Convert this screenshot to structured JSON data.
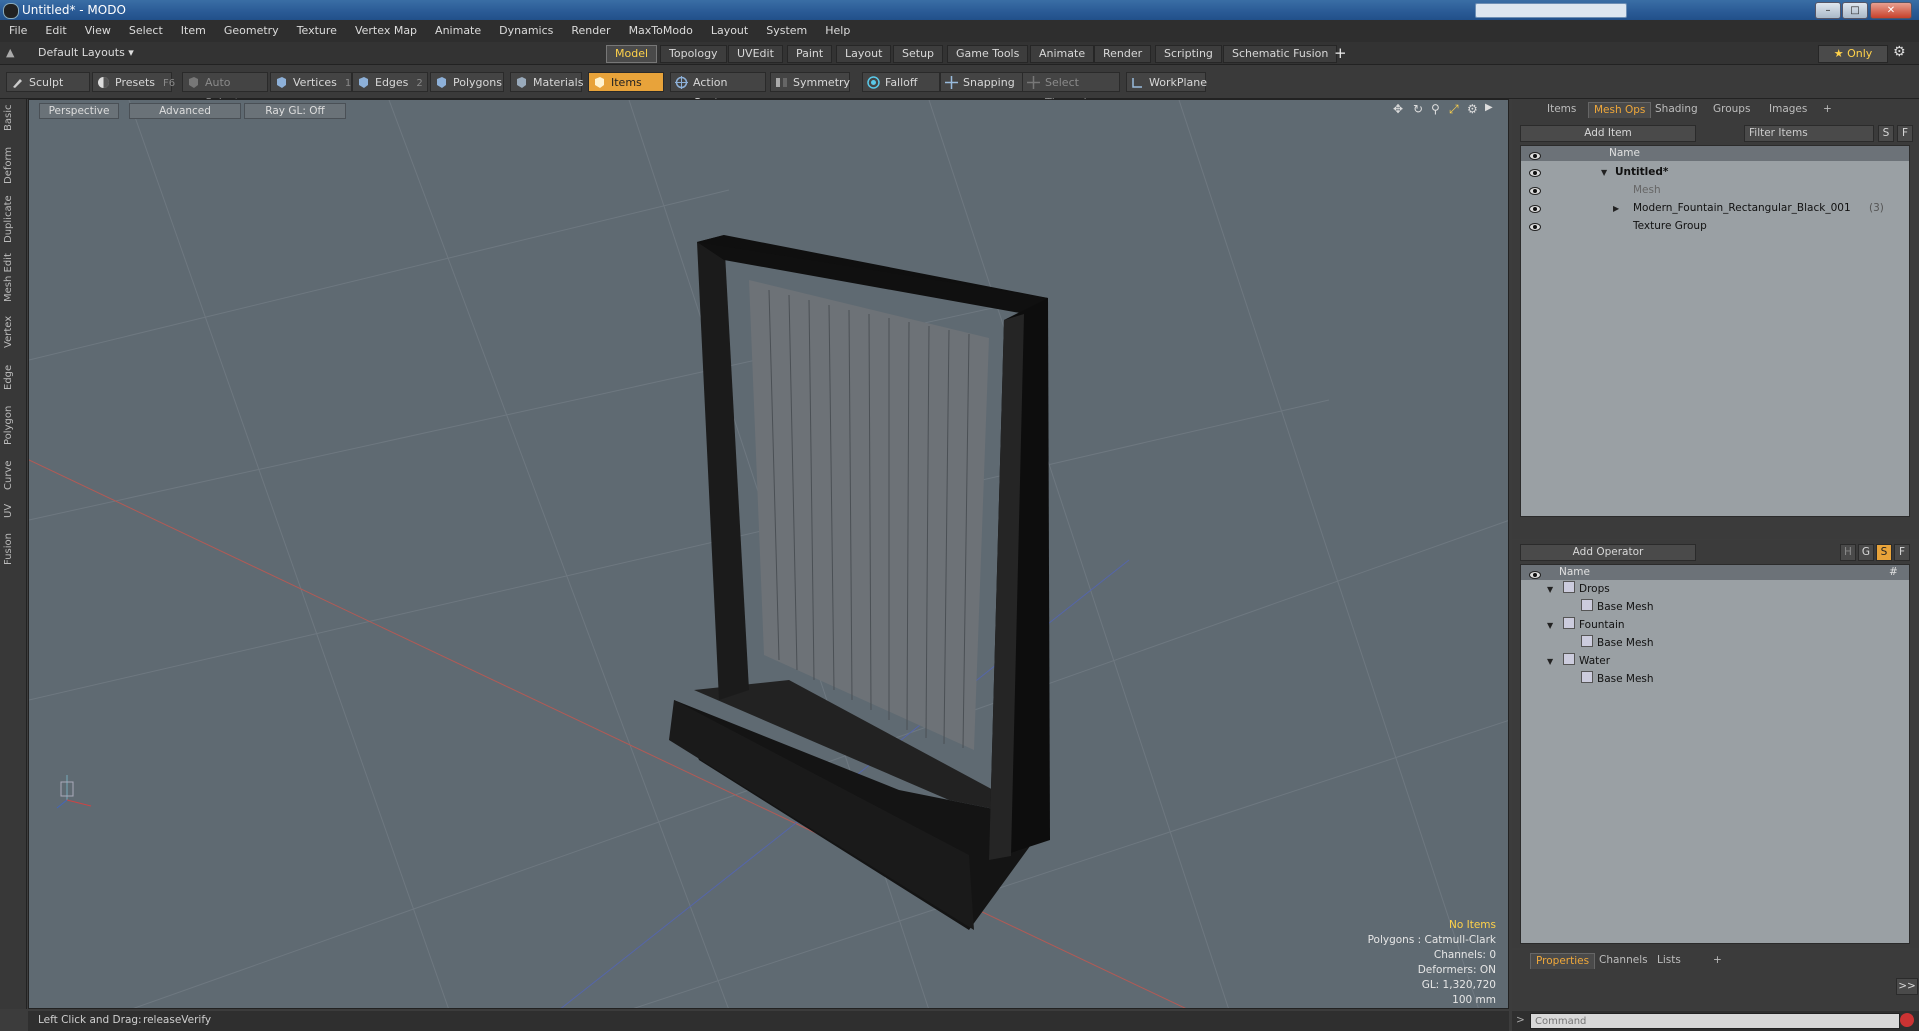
{
  "window": {
    "title": "Untitled* - MODO"
  },
  "menu": [
    "File",
    "Edit",
    "View",
    "Select",
    "Item",
    "Geometry",
    "Texture",
    "Vertex Map",
    "Animate",
    "Dynamics",
    "Render",
    "MaxToModo",
    "Layout",
    "System",
    "Help"
  ],
  "layoutbar": {
    "layouts_label": "Default Layouts ▾",
    "tabs": [
      "Model",
      "Topology",
      "UVEdit",
      "Paint",
      "Layout",
      "Setup",
      "Game Tools",
      "Animate",
      "Render",
      "Scripting",
      "Schematic Fusion"
    ],
    "active_tab": "Model",
    "add_label": "+",
    "only_label": "★ Only"
  },
  "toolbar": {
    "sculpt": "Sculpt",
    "presets": "Presets",
    "presets_key": "F6",
    "auto_select": "Auto Select",
    "vertices": "Vertices",
    "vertices_key": "1",
    "edges": "Edges",
    "edges_key": "2",
    "polygons": "Polygons",
    "materials": "Materials",
    "items": "Items",
    "action_center": "Action Center",
    "symmetry": "Symmetry",
    "falloff": "Falloff",
    "snapping": "Snapping",
    "select_through": "Select Through",
    "workplane": "WorkPlane"
  },
  "left_tabs": [
    "Basic",
    "Deform",
    "Duplicate",
    "Mesh Edit",
    "Vertex",
    "Edge",
    "Polygon",
    "Curve",
    "UV",
    "Fusion"
  ],
  "viewport": {
    "perspective": "Perspective",
    "advanced": "Advanced",
    "raygl": "Ray GL: Off",
    "info": {
      "items": "No Items",
      "polygons": "Polygons : Catmull-Clark",
      "channels": "Channels: 0",
      "deformers": "Deformers: ON",
      "gl": "GL: 1,320,720",
      "scale": "100 mm"
    }
  },
  "item_panel": {
    "tabs": [
      "Items",
      "Mesh Ops",
      "Shading",
      "Groups",
      "Images",
      "+"
    ],
    "active_tab": "Mesh Ops",
    "add_item": "Add Item",
    "filter_items": "Filter Items",
    "s_btn": "S",
    "f_btn": "F",
    "col_name": "Name",
    "tree": [
      {
        "label": "Untitled*",
        "count": ""
      },
      {
        "label": "Mesh",
        "count": ""
      },
      {
        "label": "Modern_Fountain_Rectangular_Black_001",
        "count": "(3)"
      },
      {
        "label": "Texture Group",
        "count": ""
      }
    ]
  },
  "operator_panel": {
    "add_operator": "Add Operator",
    "h_btn": "H",
    "g_btn": "G",
    "s_btn": "S",
    "f_btn": "F",
    "col_name": "Name",
    "col_hash": "#",
    "groups": [
      {
        "label": "Drops",
        "child": "Base Mesh"
      },
      {
        "label": "Fountain",
        "child": "Base Mesh"
      },
      {
        "label": "Water",
        "child": "Base Mesh"
      }
    ]
  },
  "properties_panel": {
    "tabs": [
      "Properties",
      "Channels",
      "Lists",
      "+"
    ],
    "active_tab": "Properties",
    "expand": ">>"
  },
  "status": {
    "hint": "Left Click and Drag:",
    "action": "releaseVerify",
    "command_placeholder": "Command"
  },
  "colors": {
    "accent": "#e8a33a",
    "viewport": "#5f6a72",
    "active_text": "#ffd24a"
  }
}
